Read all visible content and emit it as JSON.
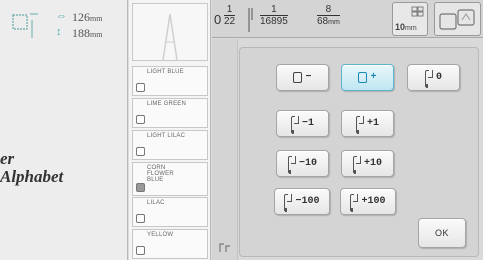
{
  "preview": {
    "width_value": "126",
    "width_unit": "mm",
    "height_value": "188",
    "height_unit": "mm",
    "design_line1": "er",
    "design_line2": "Alphabet"
  },
  "threads": [
    {
      "name": "LIGHT BLUE",
      "filled": false
    },
    {
      "name": "LIME GREEN",
      "filled": false
    },
    {
      "name": "LIGHT LILAC",
      "filled": false
    },
    {
      "name": "CORN FLOWER BLUE",
      "filled": true
    },
    {
      "name": "LILAC",
      "filled": false
    },
    {
      "name": "YELLOW",
      "filled": false
    }
  ],
  "toolbar": {
    "zero": "0",
    "frac1_num": "1",
    "frac1_den": "22",
    "frac2_num": "1",
    "frac2_den": "16895",
    "frac3_num": "8",
    "frac3_den": "68",
    "frac3_unit": "mm",
    "unit_box_label": "10",
    "unit_box_unit": "mm"
  },
  "panel": {
    "btn_minus_label": "−",
    "btn_plus_label": "+",
    "btn_needle_label": "0",
    "btn_m1": "−1",
    "btn_p1": "+1",
    "btn_m10": "−10",
    "btn_p10": "+10",
    "btn_m100": "−100",
    "btn_p100": "+100",
    "ok_label": "OK"
  },
  "colors": {
    "active_border": "#5fb3cf",
    "active_bg": "#bfe6f2",
    "active_text": "#1b88b3"
  }
}
